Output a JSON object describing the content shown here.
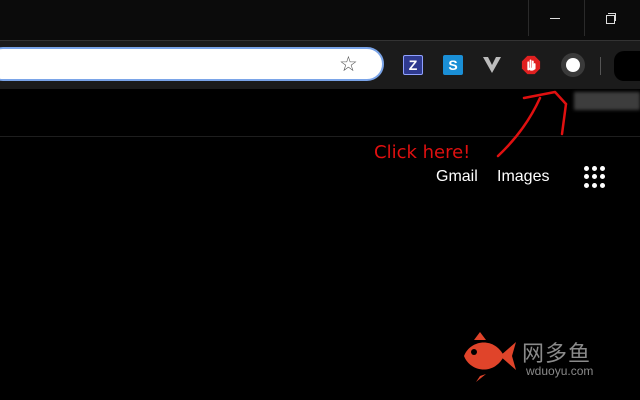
{
  "window": {
    "minimize_icon": "minimize-icon",
    "restore_icon": "restore-icon"
  },
  "toolbar": {
    "omnibox_value": "",
    "bookmark_icon": "star-icon",
    "extensions": [
      {
        "name": "z-extension",
        "label": "Z",
        "color": "#2f3a8f"
      },
      {
        "name": "s-extension",
        "label": "S",
        "color": "#1a8fd6"
      },
      {
        "name": "v-extension",
        "label": "V",
        "color": "#bbbbbb"
      },
      {
        "name": "stop-extension",
        "label": "",
        "color": "#e02020"
      },
      {
        "name": "white-circle-extension",
        "label": "",
        "color": "#ffffff"
      }
    ]
  },
  "annotation": {
    "text": "Click here!",
    "color": "#e01010"
  },
  "google": {
    "gmail": "Gmail",
    "images": "Images",
    "apps_icon": "apps-grid-icon"
  },
  "watermark": {
    "brand": "网多鱼",
    "url": "wduoyu.com",
    "color": "#e0442a"
  }
}
